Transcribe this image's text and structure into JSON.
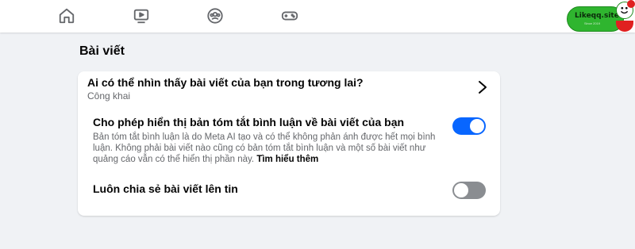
{
  "nav": {
    "items": [
      {
        "icon": "home-icon"
      },
      {
        "icon": "video-icon"
      },
      {
        "icon": "groups-icon"
      },
      {
        "icon": "gaming-icon"
      }
    ]
  },
  "badge": {
    "text": "Likeqq.site",
    "subtext": "Since 2019"
  },
  "section": {
    "title": "Bài viết"
  },
  "settings": {
    "future_posts": {
      "title": "Ai có thể nhìn thấy bài viết của bạn trong tương lai?",
      "value": "Công khai"
    },
    "comment_summary": {
      "title": "Cho phép hiển thị bản tóm tắt bình luận về bài viết của bạn",
      "description": "Bản tóm tắt bình luận là do Meta AI tạo và có thể không phản ánh được hết mọi bình luận. Không phải bài viết nào cũng có bản tóm tắt bình luận và một số bài viết như quảng cáo vẫn có thể hiển thị phần này.",
      "link": "Tìm hiểu thêm",
      "enabled": true
    },
    "share_to_story": {
      "title": "Luôn chia sẻ bài viết lên tin",
      "enabled": false
    }
  },
  "colors": {
    "toggle_on": "#0866ff",
    "toggle_off": "#8a8d91",
    "badge_green": "#2fb52f"
  }
}
